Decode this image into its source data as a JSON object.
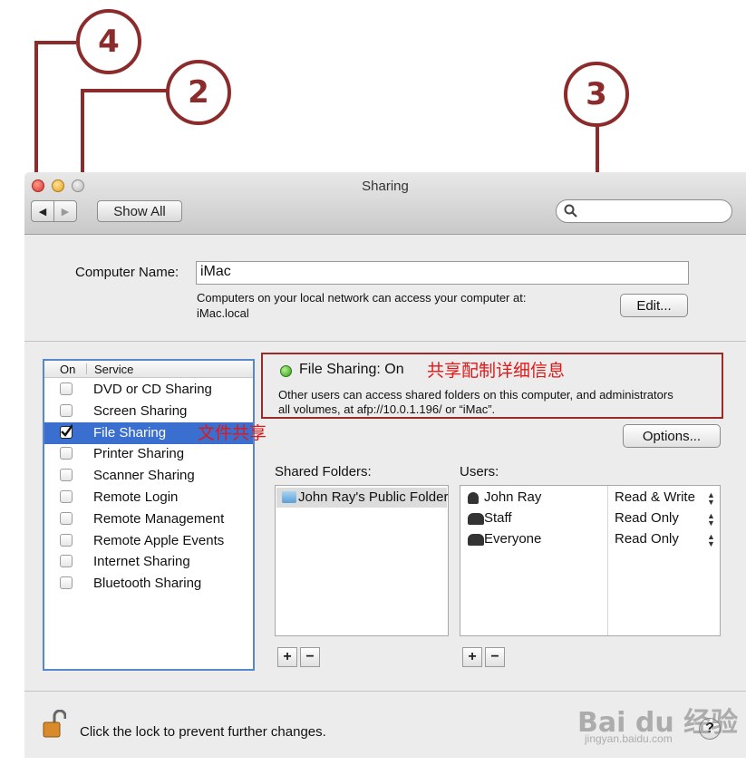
{
  "callouts": {
    "a": "4",
    "b": "2",
    "c": "3"
  },
  "window": {
    "title": "Sharing",
    "show_all": "Show All",
    "search_placeholder": ""
  },
  "computer_name": {
    "label": "Computer Name:",
    "value": "iMac",
    "desc_line1": "Computers on your local network can access your computer at:",
    "desc_line2": "iMac.local",
    "edit_button": "Edit..."
  },
  "services": {
    "header_on": "On",
    "header_service": "Service",
    "items": [
      {
        "label": "DVD or CD Sharing",
        "checked": false
      },
      {
        "label": "Screen Sharing",
        "checked": false
      },
      {
        "label": "File Sharing",
        "checked": true
      },
      {
        "label": "Printer Sharing",
        "checked": false
      },
      {
        "label": "Scanner Sharing",
        "checked": false
      },
      {
        "label": "Remote Login",
        "checked": false
      },
      {
        "label": "Remote Management",
        "checked": false
      },
      {
        "label": "Remote Apple Events",
        "checked": false
      },
      {
        "label": "Internet Sharing",
        "checked": false
      },
      {
        "label": "Bluetooth Sharing",
        "checked": false
      }
    ]
  },
  "annotations": {
    "status_note": "共享配制详细信息",
    "file_sharing_note": "文件共享"
  },
  "status": {
    "title": "File Sharing: On",
    "line1": "Other users can access shared folders on this computer, and administrators",
    "line2": "all volumes, at afp://10.0.1.196/ or “iMac”."
  },
  "options_button": "Options...",
  "shared_folders": {
    "label": "Shared Folders:",
    "items": [
      "John Ray's Public Folder"
    ]
  },
  "users": {
    "label": "Users:",
    "items": [
      {
        "name": "John Ray",
        "permission": "Read & Write"
      },
      {
        "name": "Staff",
        "permission": "Read Only"
      },
      {
        "name": "Everyone",
        "permission": "Read Only"
      }
    ]
  },
  "add_label": "+",
  "remove_label": "−",
  "footer": {
    "lock_text": "Click the lock to prevent further changes.",
    "help": "?"
  },
  "watermark": {
    "brand": "Bai du 经验",
    "url": "jingyan.baidu.com"
  },
  "colors": {
    "callout": "#8b2b2b",
    "selection": "#3a6fd0",
    "annotation_text": "#e01818"
  }
}
